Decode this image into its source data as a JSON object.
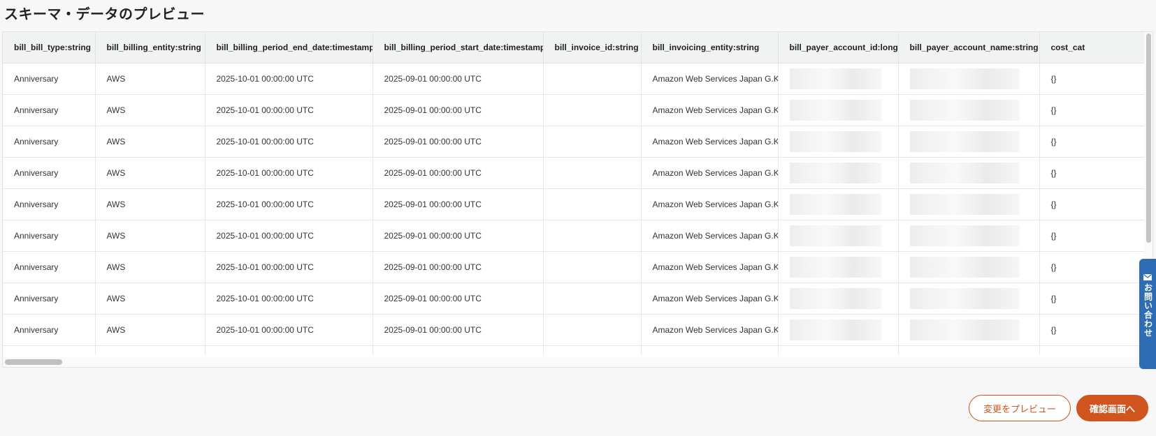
{
  "page": {
    "title": "スキーマ・データのプレビュー"
  },
  "table": {
    "columns": [
      "bill_bill_type:string",
      "bill_billing_entity:string",
      "bill_billing_period_end_date:timestamp",
      "bill_billing_period_start_date:timestamp",
      "bill_invoice_id:string",
      "bill_invoicing_entity:string",
      "bill_payer_account_id:long",
      "bill_payer_account_name:string",
      "cost_cat"
    ],
    "rows": [
      [
        "Anniversary",
        "AWS",
        "2025-10-01 00:00:00 UTC",
        "2025-09-01 00:00:00 UTC",
        "",
        "Amazon Web Services Japan G.K.",
        "",
        "",
        "{}"
      ],
      [
        "Anniversary",
        "AWS",
        "2025-10-01 00:00:00 UTC",
        "2025-09-01 00:00:00 UTC",
        "",
        "Amazon Web Services Japan G.K.",
        "",
        "",
        "{}"
      ],
      [
        "Anniversary",
        "AWS",
        "2025-10-01 00:00:00 UTC",
        "2025-09-01 00:00:00 UTC",
        "",
        "Amazon Web Services Japan G.K.",
        "",
        "",
        "{}"
      ],
      [
        "Anniversary",
        "AWS",
        "2025-10-01 00:00:00 UTC",
        "2025-09-01 00:00:00 UTC",
        "",
        "Amazon Web Services Japan G.K.",
        "",
        "",
        "{}"
      ],
      [
        "Anniversary",
        "AWS",
        "2025-10-01 00:00:00 UTC",
        "2025-09-01 00:00:00 UTC",
        "",
        "Amazon Web Services Japan G.K.",
        "",
        "",
        "{}"
      ],
      [
        "Anniversary",
        "AWS",
        "2025-10-01 00:00:00 UTC",
        "2025-09-01 00:00:00 UTC",
        "",
        "Amazon Web Services Japan G.K.",
        "",
        "",
        "{}"
      ],
      [
        "Anniversary",
        "AWS",
        "2025-10-01 00:00:00 UTC",
        "2025-09-01 00:00:00 UTC",
        "",
        "Amazon Web Services Japan G.K.",
        "",
        "",
        "{}"
      ],
      [
        "Anniversary",
        "AWS",
        "2025-10-01 00:00:00 UTC",
        "2025-09-01 00:00:00 UTC",
        "",
        "Amazon Web Services Japan G.K.",
        "",
        "",
        "{}"
      ],
      [
        "Anniversary",
        "AWS",
        "2025-10-01 00:00:00 UTC",
        "2025-09-01 00:00:00 UTC",
        "",
        "Amazon Web Services Japan G.K.",
        "",
        "",
        "{}"
      ]
    ]
  },
  "contact_tab": {
    "label": "お問い合わせ",
    "icon": "mail-icon"
  },
  "actions": {
    "preview_label": "変更をプレビュー",
    "confirm_label": "確認画面へ"
  },
  "colors": {
    "accent": "#d0541d",
    "contact_tab": "#2d6db5",
    "header_bg": "#f1f2f2"
  }
}
